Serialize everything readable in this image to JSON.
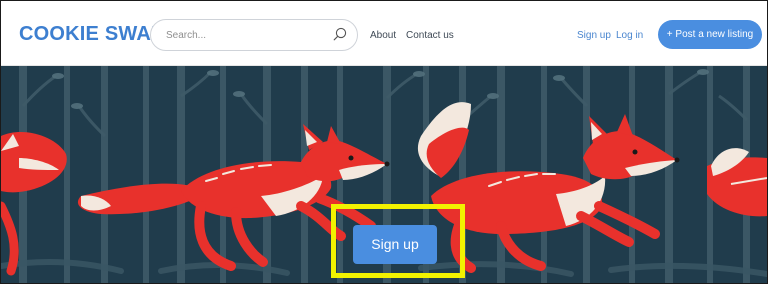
{
  "header": {
    "logo": "COOKIE SWAP",
    "search": {
      "placeholder": "Search..."
    },
    "nav": [
      {
        "label": "About"
      },
      {
        "label": "Contact us"
      }
    ],
    "auth": {
      "signup_label": "Sign up",
      "login_label": "Log in"
    },
    "post_button_label": "+ Post a new listing"
  },
  "hero": {
    "cta_label": "Sign up"
  },
  "colors": {
    "brand": "#3d7fd0",
    "button": "#4a8ee0",
    "hero_background": "#1f3b4a",
    "fox": "#e8312c",
    "highlight": "#f2f200"
  },
  "icons": [
    "search-icon"
  ]
}
